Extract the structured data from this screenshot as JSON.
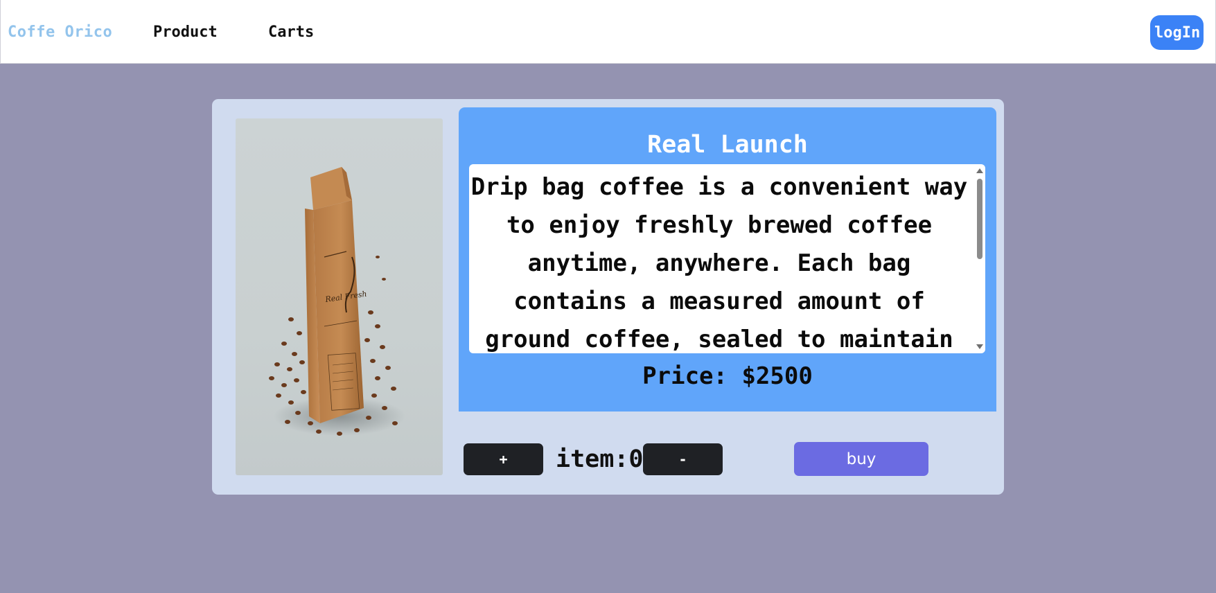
{
  "navbar": {
    "brand": "Coffe Orico",
    "links": [
      "Product",
      "Carts"
    ],
    "login_label": "logIn"
  },
  "product": {
    "image_alt": "coffee bag with beans",
    "title": "Real Launch",
    "description": "Drip bag coffee is a convenient way to enjoy freshly brewed coffee anytime, anywhere. Each bag contains a measured amount of ground coffee, sealed to maintain its aroma and freshness.",
    "price": "Price: $2500",
    "plus_label": "+",
    "minus_label": "-",
    "item_count": "item:0",
    "buy_label": "buy"
  },
  "colors": {
    "background": "#9493b1",
    "card": "#d0dbef",
    "info_panel": "#60a5fa",
    "login_button": "#3b82f6",
    "buy_button": "#6b6be2",
    "qty_button": "#1f2125",
    "brand_text": "#93c4ec"
  }
}
